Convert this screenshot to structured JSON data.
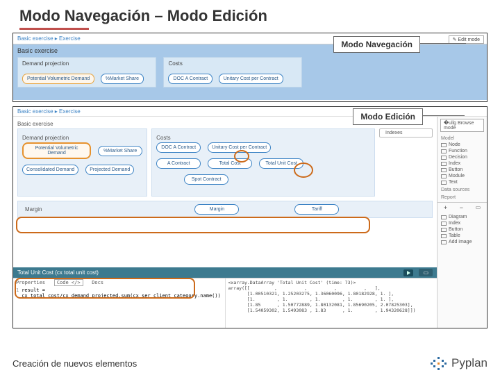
{
  "title": "Modo Navegación – Modo Edición",
  "callouts": {
    "nav": "Modo Navegación",
    "edit": "Modo Edición"
  },
  "panel1": {
    "breadcrumb": "Basic exercise ▸ Exercise",
    "editBtn": "✎ Edit mode",
    "section": "Basic exercise",
    "groupA": {
      "label": "Demand projection",
      "nodes": [
        "Potential Volumetric Demand",
        "%Market Share"
      ]
    },
    "groupB": {
      "label": "Costs",
      "nodes": [
        "DOC A Contract",
        "Unitary Cost per Contract"
      ]
    }
  },
  "panel2": {
    "breadcrumb": "Basic exercise ▸ Exercise",
    "browseBtn": "�ullg Browse mode",
    "section": "Basic exercise",
    "sidebar": {
      "model": "Model",
      "items": [
        "Node",
        "Function",
        "Decision",
        "Index",
        "Button",
        "Module",
        "Text"
      ],
      "dataSources": "Data sources",
      "report": "Report",
      "reportItems": [
        "Diagram",
        "Index",
        "Button",
        "Table",
        "Add image"
      ]
    },
    "diagram": {
      "demand": {
        "label": "Demand projection",
        "row1": [
          "Potential Volumetric Demand",
          "%Market Share"
        ],
        "row2": [
          "Consolidated Demand",
          "Projected Demand"
        ]
      },
      "costs": {
        "label": "Costs",
        "row1": [
          "DOC A Contract",
          "Unitary Cost per Contract"
        ],
        "row2": [
          "A Contract",
          "Total Cost",
          "Total Unit Cost"
        ],
        "row3": [
          "Spot Contract"
        ]
      },
      "indexes": "Indexes",
      "margin": {
        "label": "Margin",
        "nodes": [
          "Margin",
          "Tariff"
        ]
      }
    },
    "tabbar": {
      "title": "Total Unit Cost (cx total unit cost)"
    },
    "code": {
      "leftTabs": [
        "Properties",
        "Code </>",
        "Docs"
      ],
      "leftLine": "result = cx_total_cost/cx_demand_projected.sum(cx_ser_client_category.name())",
      "right": "<xarray.DataArray 'Total Unit Cost' (time: 73)>\narray([[         ,          ,          ,          ,   ],\n       [1.00510321, 1.25203275, 1.36060096, 1.80182928, 1. ],\n       [1.        , 1.        , 1.        , 1.        , 1. ],\n       [1.85      , 1.50772889, 1.80132081, 1.85690205, 2.07825303],\n       [1.54059302, 1.5493083 , 1.83      , 1.        , 1.94320628]])"
    }
  },
  "footer": {
    "text": "Creación de nuevos elementos",
    "brand": "Pyplan"
  }
}
